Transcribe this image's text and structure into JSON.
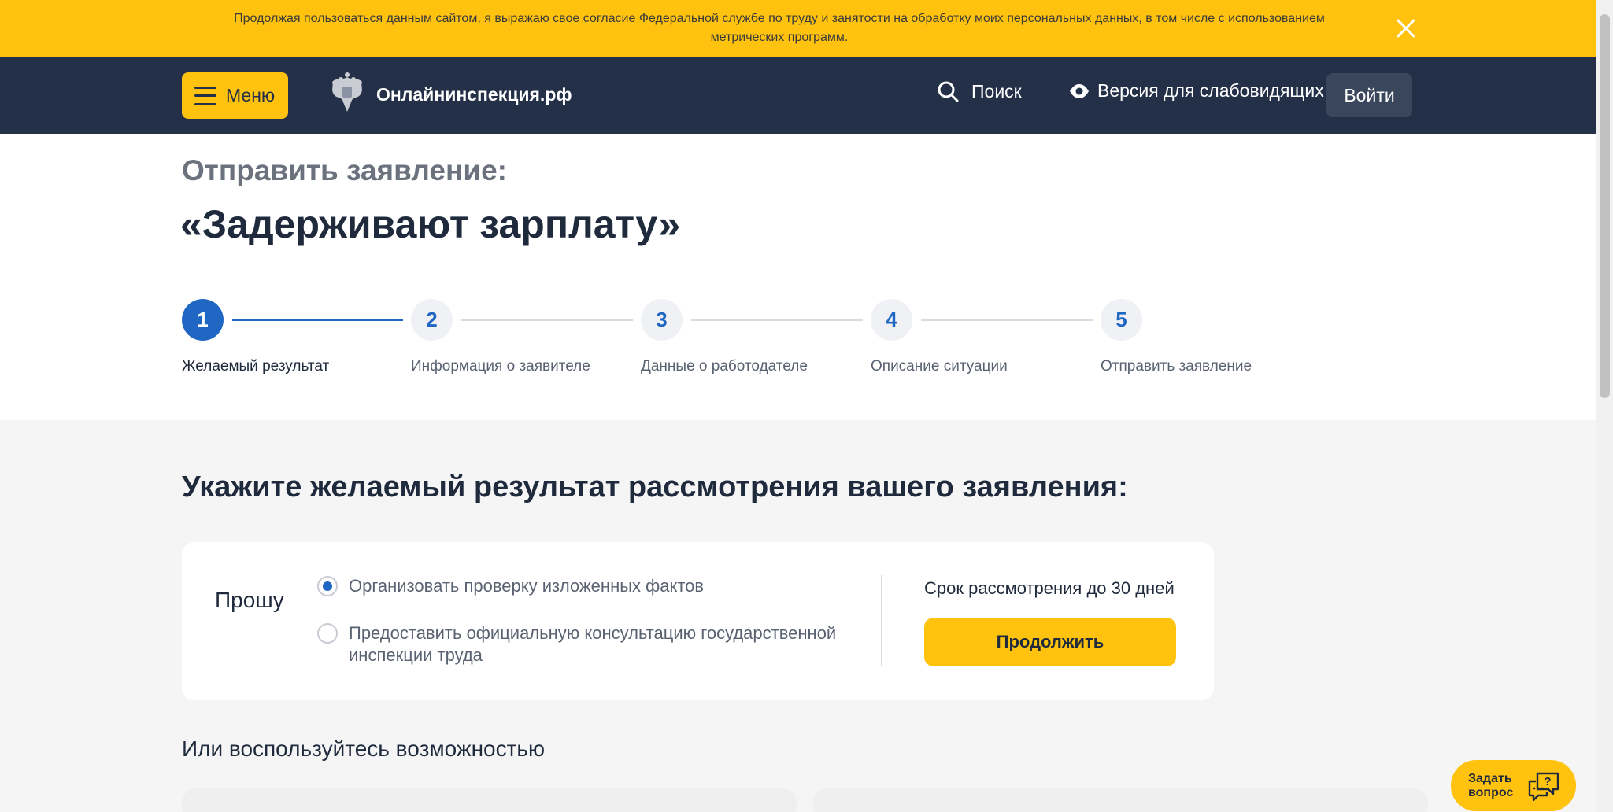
{
  "cookie_banner": {
    "text": "Продолжая пользоваться данным сайтом, я выражаю свое согласие Федеральной службе по труду и занятости на обработку моих персональных данных, в том числе с использованием метрических программ."
  },
  "header": {
    "menu_label": "Меню",
    "logo_text": "Онлайнинспекция.рф",
    "search_label": "Поиск",
    "vision_label": "Версия для слабовидящих",
    "login_label": "Войти"
  },
  "page": {
    "subtitle": "Отправить заявление:",
    "title": "«Задерживают зарплату»"
  },
  "steps": [
    {
      "number": "1",
      "label": "Желаемый результат",
      "active": true
    },
    {
      "number": "2",
      "label": "Информация о заявителе",
      "active": false
    },
    {
      "number": "3",
      "label": "Данные о работодателе",
      "active": false
    },
    {
      "number": "4",
      "label": "Описание ситуации",
      "active": false
    },
    {
      "number": "5",
      "label": "Отправить заявление",
      "active": false
    }
  ],
  "form": {
    "question": "Укажите желаемый результат рассмотрения вашего заявления:",
    "ask_label": "Прошу",
    "options": [
      {
        "label": "Организовать проверку изложенных фактов",
        "selected": true
      },
      {
        "label": "Предоставить официальную консультацию государственной инспекции труда",
        "selected": false
      }
    ],
    "deadline": "Срок рассмотрения до 30 дней",
    "continue_label": "Продолжить"
  },
  "alternative": {
    "heading": "Или воспользуйтесь возможностью"
  },
  "ask_button": {
    "label": "Задать вопрос"
  },
  "colors": {
    "accent_yellow": "#ffc20e",
    "header_dark": "#243048",
    "primary_blue": "#1f67c2"
  }
}
